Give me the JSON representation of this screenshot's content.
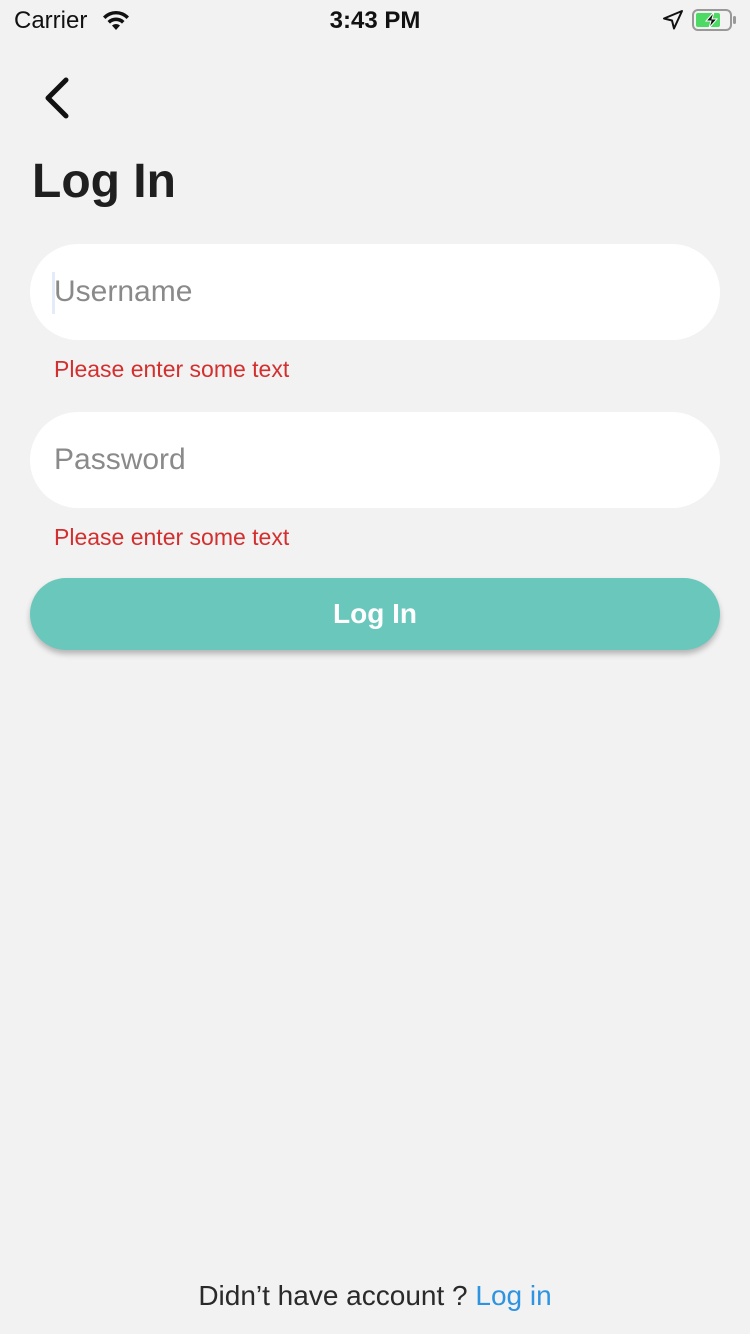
{
  "status_bar": {
    "carrier": "Carrier",
    "time": "3:43 PM",
    "icons": [
      "wifi-icon",
      "location-arrow-icon",
      "battery-charging-icon"
    ],
    "battery_color": "#4cd964"
  },
  "header": {
    "back_icon": "chevron-left-icon",
    "title": "Log In"
  },
  "form": {
    "username": {
      "placeholder": "Username",
      "value": "",
      "error": "Please enter some text"
    },
    "password": {
      "placeholder": "Password",
      "value": "",
      "error": "Please enter some text"
    },
    "submit_label": "Log In"
  },
  "footer": {
    "prompt": "Didn’t have account ? ",
    "link_label": "Log in"
  },
  "colors": {
    "background": "#f2f2f2",
    "accent": "#69c7bb",
    "error": "#d32f2f",
    "link": "#2e93e0"
  }
}
